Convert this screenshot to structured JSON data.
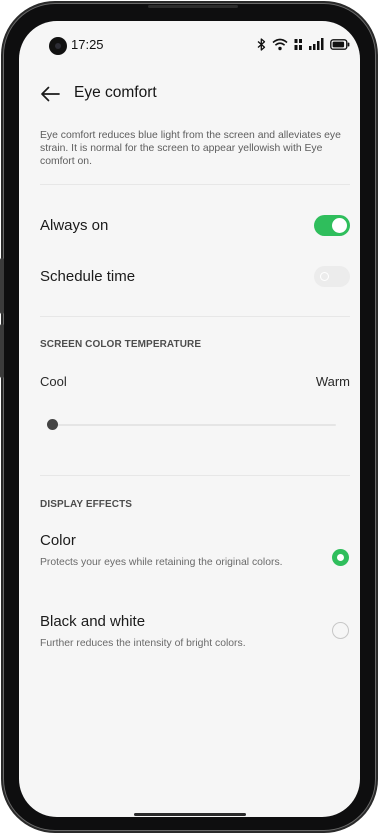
{
  "status_bar": {
    "time": "17:25",
    "icons": [
      "bluetooth-icon",
      "wifi-icon",
      "hd-data-icon",
      "signal-icon",
      "battery-icon"
    ]
  },
  "header": {
    "back_icon": "back-arrow-icon",
    "title": "Eye comfort"
  },
  "description": "Eye comfort reduces blue light from the screen and alleviates eye strain. It is normal for the screen to appear yellowish with Eye comfort on.",
  "settings": {
    "always_on": {
      "label": "Always on",
      "enabled": true
    },
    "schedule_time": {
      "label": "Schedule time",
      "enabled": false
    }
  },
  "color_temperature": {
    "section_title": "SCREEN COLOR TEMPERATURE",
    "cool_label": "Cool",
    "warm_label": "Warm",
    "level": 0
  },
  "display_effects": {
    "section_title": "DISPLAY EFFECTS",
    "options": [
      {
        "title": "Color",
        "subtitle": "Protects your eyes while retaining the original colors.",
        "selected": true
      },
      {
        "title": "Black and white",
        "subtitle": "Further reduces the intensity of bright colors.",
        "selected": false
      }
    ]
  },
  "colors": {
    "accent": "#2fbe5c",
    "background": "#f6f6f6",
    "text_primary": "#1b1b1b",
    "text_secondary": "#6a6a6a"
  }
}
